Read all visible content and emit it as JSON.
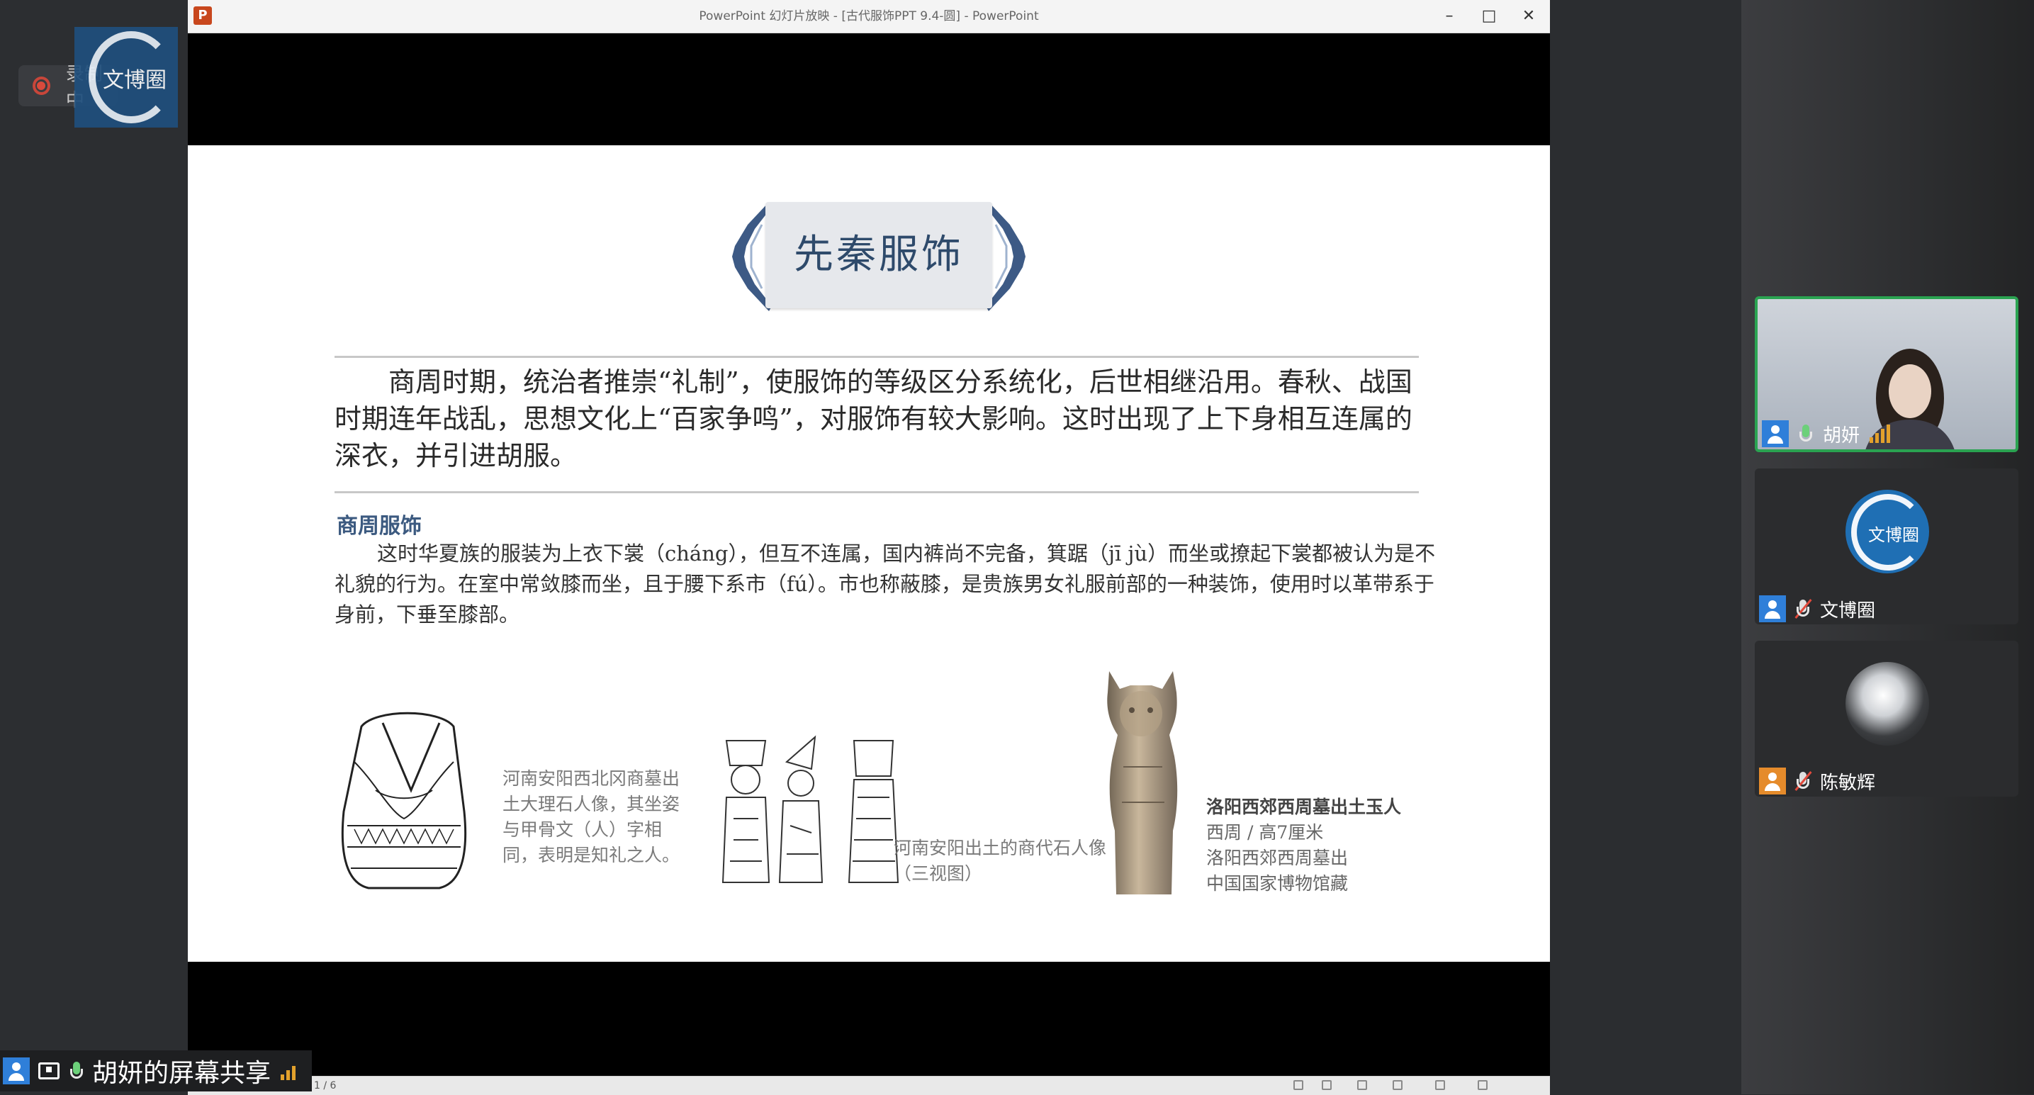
{
  "meeting": {
    "recording_label": "录制中",
    "host_logo_text": "文博圈",
    "share_label": "胡妍的屏幕共享"
  },
  "ppt": {
    "window_title": "PowerPoint 幻灯片放映 - [古代服饰PPT 9.4-圆] - PowerPoint",
    "status_slide": "1 / 6",
    "controls": {
      "minimize": "–",
      "maximize": "□",
      "close": "✕"
    }
  },
  "slide": {
    "title": "先秦服饰",
    "intro": "商周时期，统治者推崇“礼制”，使服饰的等级区分系统化，后世相继沿用。春秋、战国时期连年战乱，思想文化上“百家争鸣”，对服饰有较大影响。这时出现了上下身相互连属的深衣，并引进胡服。",
    "section_heading": "商周服饰",
    "section_body": "这时华夏族的服装为上衣下裳（cháng），但互不连属，国内裤尚不完备，箕踞（jī jù）而坐或撩起下裳都被认为是不礼貌的行为。在室中常敛膝而坐，且于腰下系市（fú）。市也称蔽膝，是贵族男女礼服前部的一种装饰，使用时以革带系于身前，下垂至膝部。",
    "caption_figure1": "河南安阳西北冈商墓出土大理石人像，其坐姿与甲骨文（人）字相同，表明是知礼之人。",
    "caption_figure2": "河南安阳出土的商代石人像（三视图）",
    "caption_jade_title": "洛阳西郊西周墓出土玉人",
    "caption_jade_lines": [
      "西周 / 高7厘米",
      "洛阳西郊西周墓出",
      "中国国家博物馆藏"
    ]
  },
  "participants": [
    {
      "name": "胡妍",
      "mic": "on",
      "video": "webcam"
    },
    {
      "name": "文博圈",
      "mic": "muted",
      "avatar_text": "文博圈"
    },
    {
      "name": "陈敏辉",
      "mic": "muted",
      "avatar": "photo"
    }
  ],
  "colors": {
    "accent_green": "#2aa351",
    "user_blue": "#2f7fd9",
    "user_orange": "#e58b2b",
    "slide_title": "#2e4a6b",
    "section_heading": "#3c5a80"
  }
}
